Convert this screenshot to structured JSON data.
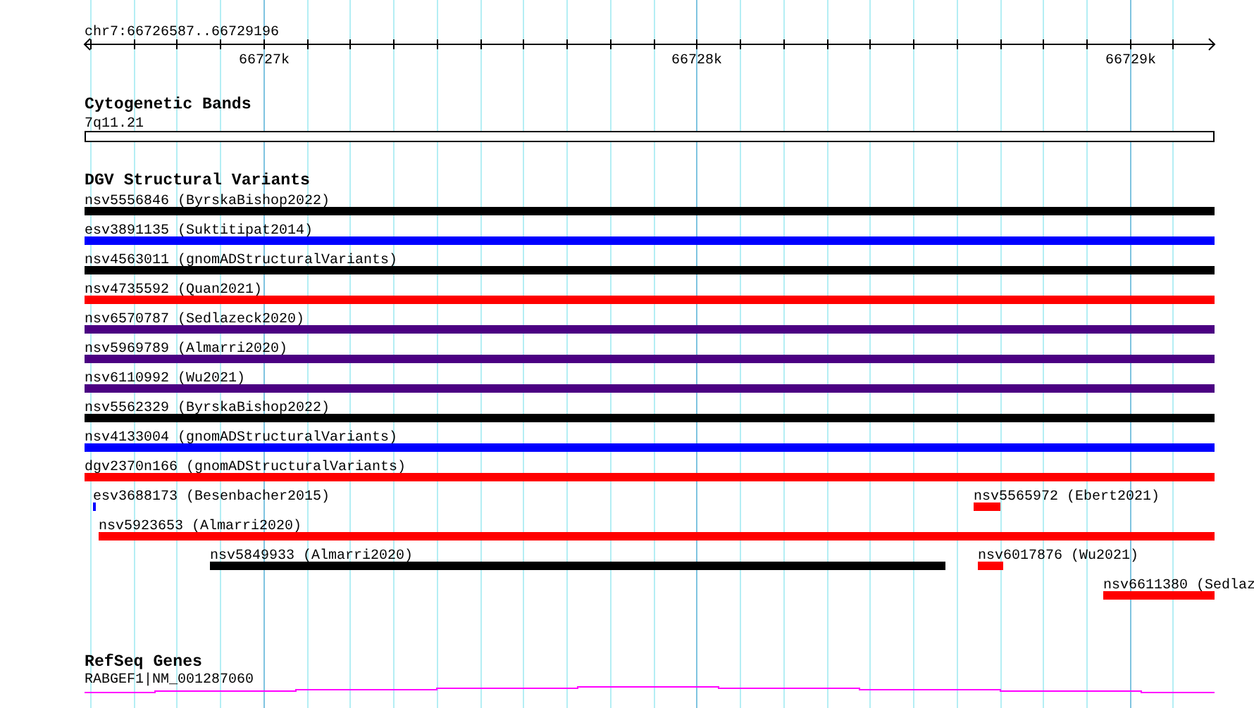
{
  "ruler": {
    "location": "chr7:66726587..66729196",
    "ticks": [
      "66727k",
      "66728k",
      "66729k"
    ]
  },
  "tracks": [
    {
      "title": "Cytogenetic Bands",
      "kind": "bands",
      "features": [
        {
          "label": "7q11.21"
        }
      ]
    },
    {
      "title": "DGV Structural Variants",
      "kind": "variants",
      "features": [
        {
          "label": "nsv5556846 (ByrskaBishop2022)",
          "color": "#000000"
        },
        {
          "label": "esv3891135 (Suktitipat2014)",
          "color": "#0000ff"
        },
        {
          "label": "nsv4563011 (gnomADStructuralVariants)",
          "color": "#000000"
        },
        {
          "label": "nsv4735592 (Quan2021)",
          "color": "#ff0000"
        },
        {
          "label": "nsv6570787 (Sedlazeck2020)",
          "color": "#4b0082"
        },
        {
          "label": "nsv5969789 (Almarri2020)",
          "color": "#4b0082"
        },
        {
          "label": "nsv6110992 (Wu2021)",
          "color": "#4b0082"
        },
        {
          "label": "nsv5562329 (ByrskaBishop2022)",
          "color": "#000000"
        },
        {
          "label": "nsv4133004 (gnomADStructuralVariants)",
          "color": "#0000ff"
        },
        {
          "label": "dgv2370n166 (gnomADStructuralVariants)",
          "color": "#ff0000"
        },
        {
          "label": "esv3688173 (Besenbacher2015)",
          "color": "#0000ff"
        },
        {
          "label": "nsv5565972 (Ebert2021)",
          "color": "#ff0000"
        },
        {
          "label": "nsv5923653 (Almarri2020)",
          "color": "#ff0000"
        },
        {
          "label": "nsv5849933 (Almarri2020)",
          "color": "#000000"
        },
        {
          "label": "nsv6017876 (Wu2021)",
          "color": "#ff0000"
        },
        {
          "label": "nsv6611380 (Sedlaz",
          "color": "#ff0000"
        }
      ]
    },
    {
      "title": "RefSeq Genes",
      "kind": "genes",
      "features": [
        {
          "label": "RABGEF1|NM_001287060",
          "color": "#ff00ff"
        }
      ]
    }
  ]
}
